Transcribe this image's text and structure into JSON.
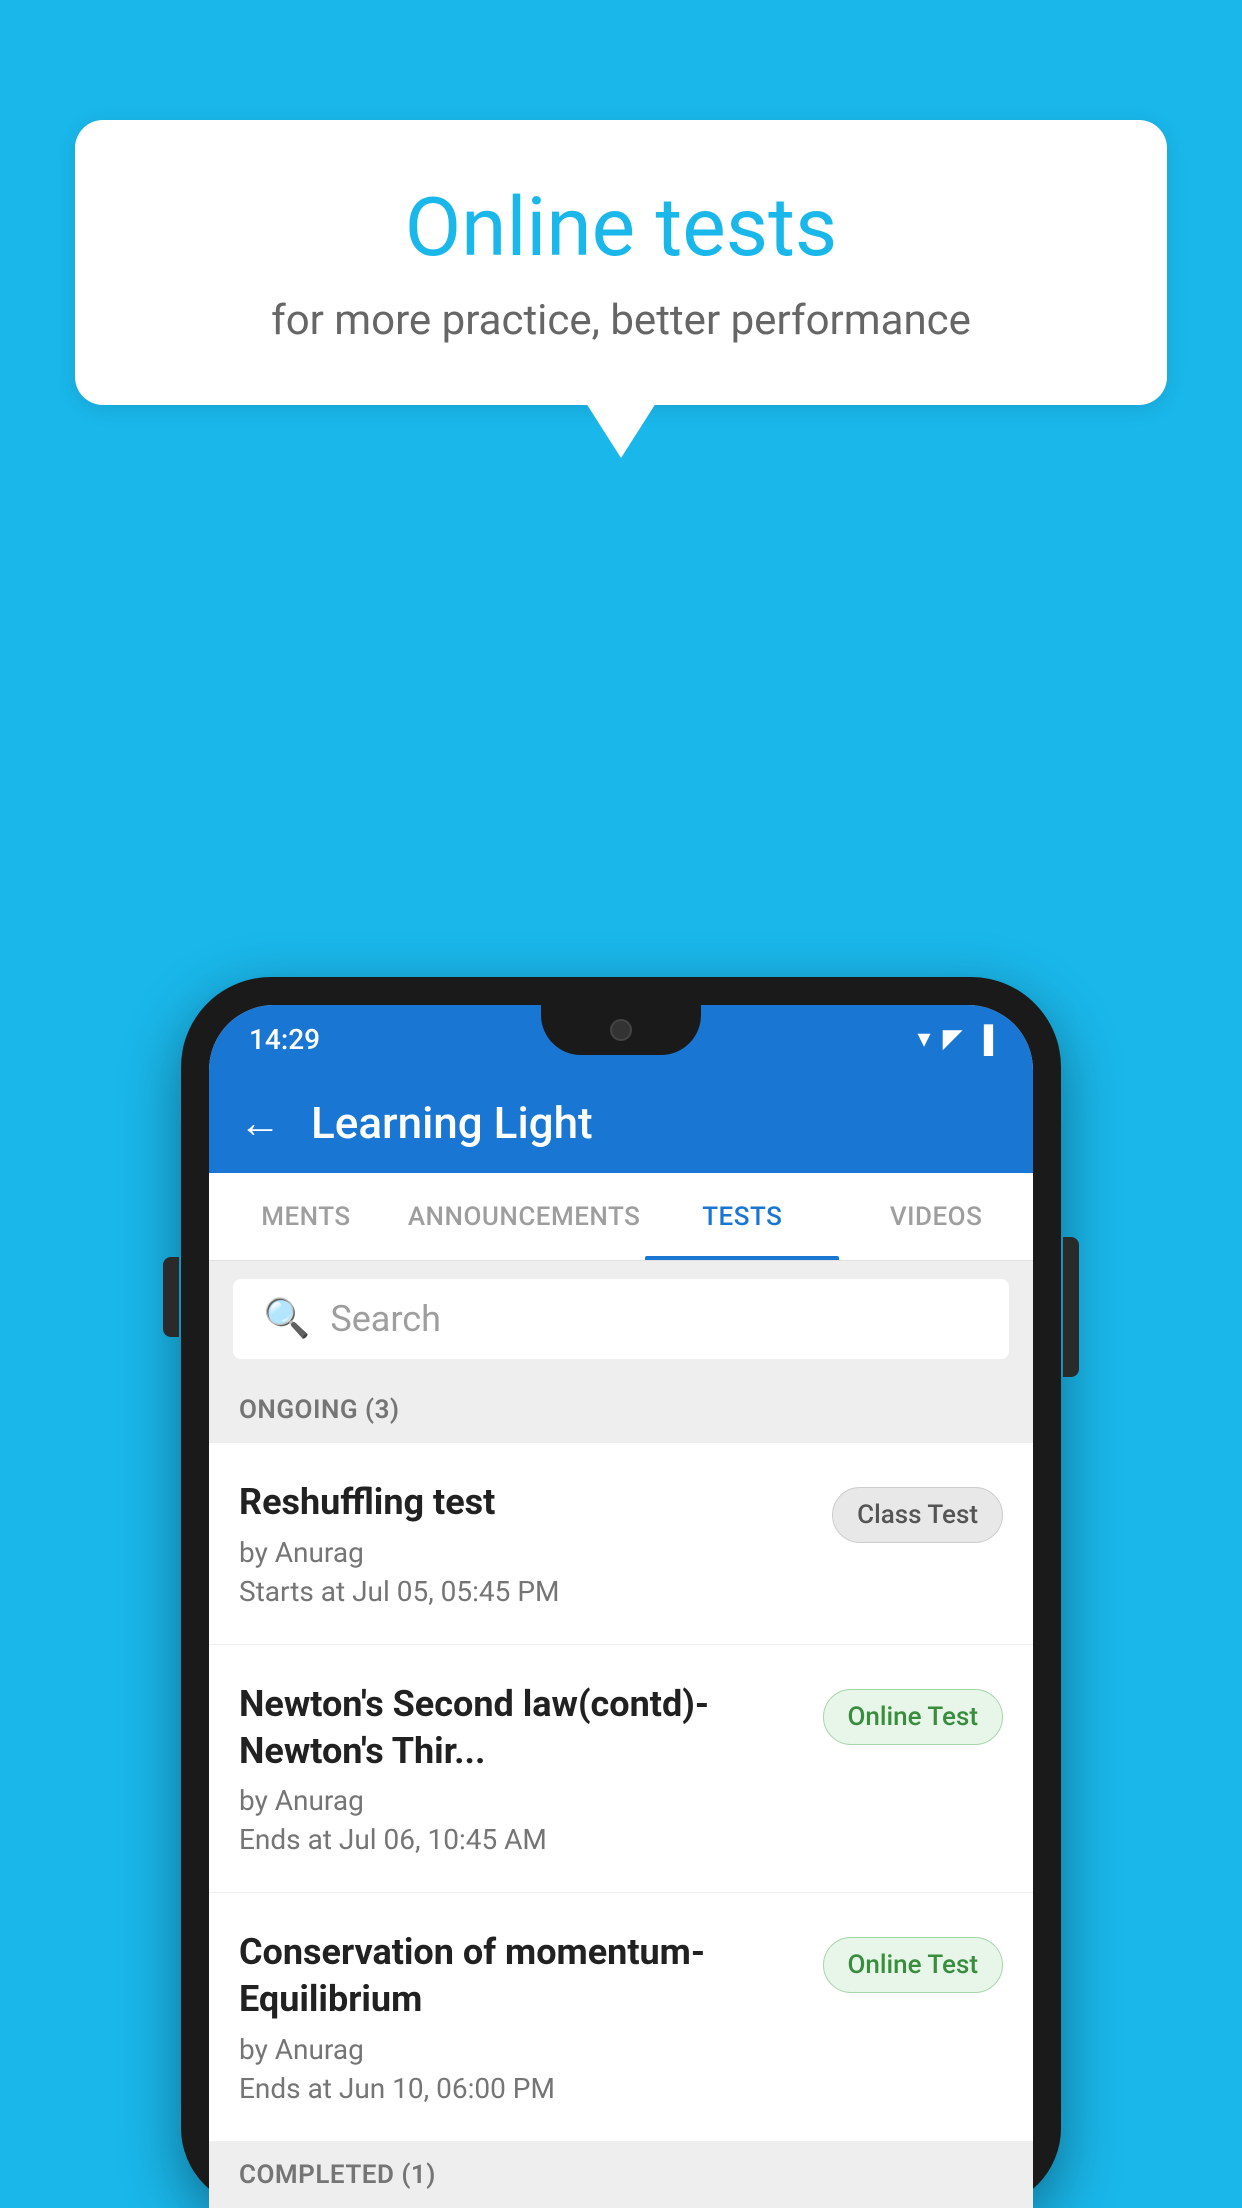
{
  "background": {
    "color": "#1ab7ea"
  },
  "speech_bubble": {
    "title": "Online tests",
    "subtitle": "for more practice, better performance"
  },
  "status_bar": {
    "time": "14:29",
    "wifi_icon": "▾",
    "signal_icon": "▲",
    "battery_icon": "▌"
  },
  "app_bar": {
    "back_label": "←",
    "title": "Learning Light"
  },
  "tabs": [
    {
      "label": "MENTS",
      "active": false
    },
    {
      "label": "ANNOUNCEMENTS",
      "active": false
    },
    {
      "label": "TESTS",
      "active": true
    },
    {
      "label": "VIDEOS",
      "active": false
    }
  ],
  "search": {
    "placeholder": "Search"
  },
  "ongoing_section": {
    "label": "ONGOING (3)"
  },
  "tests": [
    {
      "name": "Reshuffling test",
      "by": "by Anurag",
      "date": "Starts at  Jul 05, 05:45 PM",
      "badge": "Class Test",
      "badge_type": "class"
    },
    {
      "name": "Newton's Second law(contd)-Newton's Thir...",
      "by": "by Anurag",
      "date": "Ends at  Jul 06, 10:45 AM",
      "badge": "Online Test",
      "badge_type": "online"
    },
    {
      "name": "Conservation of momentum-Equilibrium",
      "by": "by Anurag",
      "date": "Ends at  Jun 10, 06:00 PM",
      "badge": "Online Test",
      "badge_type": "online"
    }
  ],
  "completed_section": {
    "label": "COMPLETED (1)"
  }
}
